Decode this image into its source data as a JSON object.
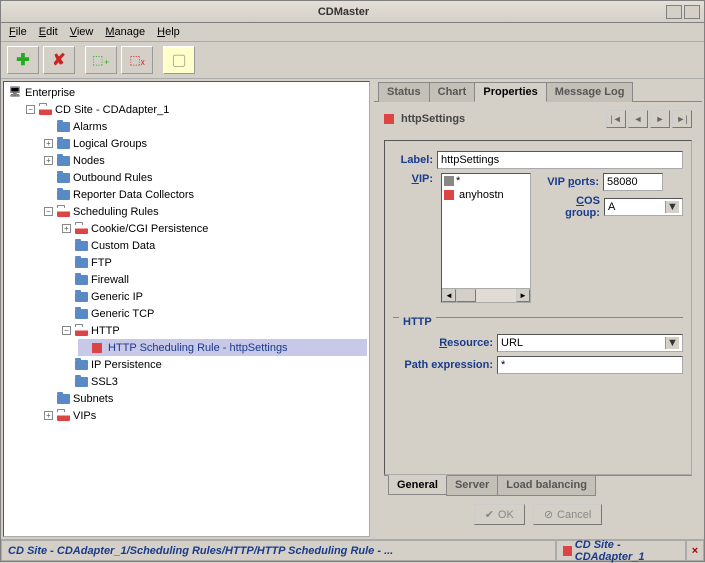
{
  "window": {
    "title": "CDMaster"
  },
  "menu": {
    "file": "File",
    "edit": "Edit",
    "view": "View",
    "manage": "Manage",
    "help": "Help"
  },
  "tree": {
    "root": "Enterprise",
    "site": "CD Site - CDAdapter_1",
    "alarms": "Alarms",
    "logical_groups": "Logical Groups",
    "nodes": "Nodes",
    "outbound_rules": "Outbound Rules",
    "reporter": "Reporter Data Collectors",
    "scheduling_rules": "Scheduling Rules",
    "cookie": "Cookie/CGI Persistence",
    "custom": "Custom Data",
    "ftp": "FTP",
    "firewall": "Firewall",
    "generic_ip": "Generic IP",
    "generic_tcp": "Generic TCP",
    "http": "HTTP",
    "http_rule": "HTTP Scheduling Rule - httpSettings",
    "ip_persist": "IP Persistence",
    "ssl3": "SSL3",
    "subnets": "Subnets",
    "vips": "VIPs"
  },
  "tabs_top": {
    "status": "Status",
    "chart": "Chart",
    "properties": "Properties",
    "msglog": "Message Log"
  },
  "prop": {
    "title": "httpSettings",
    "label_lbl": "Label:",
    "label_val": "httpSettings",
    "vip_lbl": "VIP:",
    "vip_all": "*",
    "vip_host": "anyhostn",
    "ports_lbl": "VIP ports:",
    "ports_val": "58080",
    "cos_lbl": "COS group:",
    "cos_val": "A",
    "http_section": "HTTP",
    "resource_lbl": "Resource:",
    "resource_val": "URL",
    "path_lbl": "Path expression:",
    "path_val": "*"
  },
  "tabs_bottom": {
    "general": "General",
    "server": "Server",
    "load": "Load balancing"
  },
  "buttons": {
    "ok": "OK",
    "cancel": "Cancel"
  },
  "status": {
    "path": "CD Site - CDAdapter_1/Scheduling Rules/HTTP/HTTP Scheduling Rule - ...",
    "site": "CD Site - CDAdapter_1"
  }
}
